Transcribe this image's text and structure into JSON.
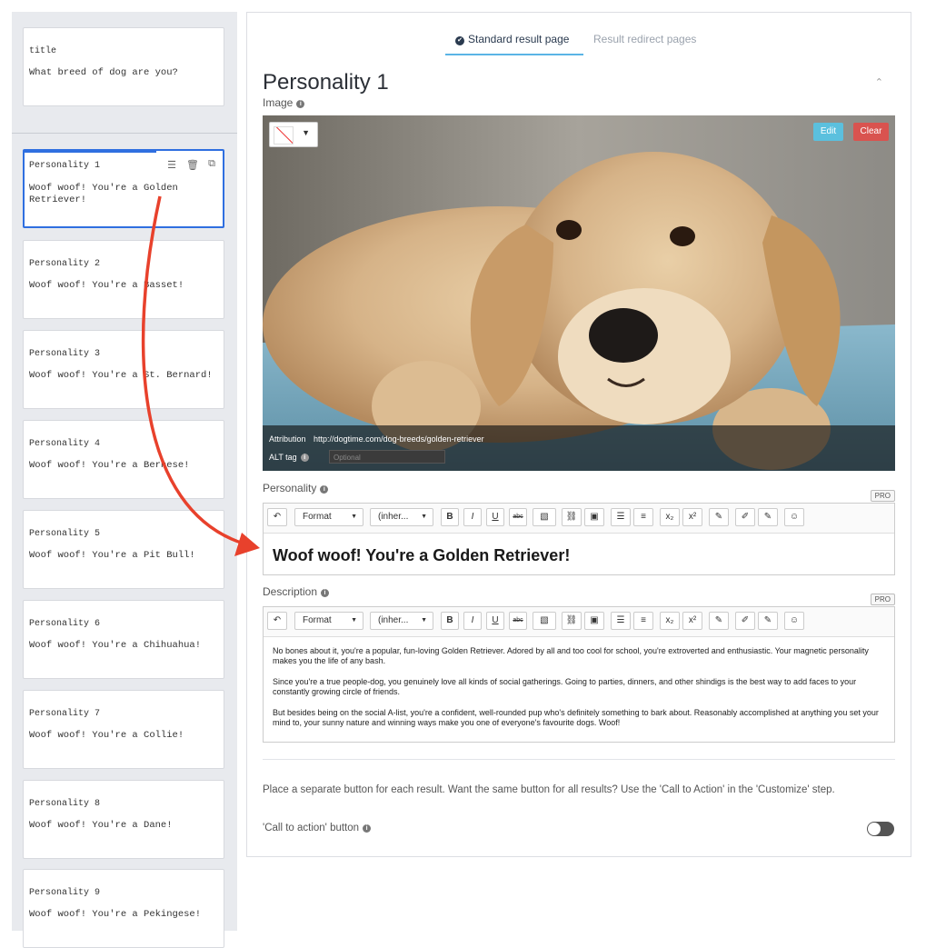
{
  "sidebar": {
    "title_card": {
      "label": "title",
      "text": "What breed of dog are you?"
    },
    "items": [
      {
        "label": "Personality 1",
        "text": "Woof woof! You're a Golden Retriever!"
      },
      {
        "label": "Personality 2",
        "text": "Woof woof! You're a Basset!"
      },
      {
        "label": "Personality 3",
        "text": "Woof woof! You're a St. Bernard!"
      },
      {
        "label": "Personality 4",
        "text": "Woof woof! You're a Bernese!"
      },
      {
        "label": "Personality 5",
        "text": "Woof woof! You're a Pit Bull!"
      },
      {
        "label": "Personality 6",
        "text": "Woof woof! You're a Chihuahua!"
      },
      {
        "label": "Personality 7",
        "text": "Woof woof! You're a Collie!"
      },
      {
        "label": "Personality 8",
        "text": "Woof woof! You're a Dane!"
      },
      {
        "label": "Personality 9",
        "text": "Woof woof! You're a Pekingese!"
      }
    ],
    "selected_index": 0,
    "tool_icons": [
      "list-icon",
      "trash-icon",
      "copy-icon"
    ]
  },
  "tabs": {
    "standard": "Standard result page",
    "redirect": "Result redirect pages",
    "active": "standard"
  },
  "main": {
    "title": "Personality 1",
    "image_label": "Image",
    "image": {
      "edit_label": "Edit",
      "clear_label": "Clear",
      "attribution_key": "Attribution",
      "attribution_value": "http://dogtime.com/dog-breeds/golden-retriever",
      "alt_label": "ALT tag",
      "alt_placeholder": "Optional"
    },
    "personality_label": "Personality",
    "personality_text": "Woof woof! You're a Golden Retriever!",
    "description_label": "Description",
    "description_paragraphs": [
      "No bones about it, you're a popular, fun-loving Golden Retriever. Adored by all and too cool for school, you're extroverted and enthusiastic. Your magnetic personality makes you the life of any bash.",
      "Since you're a true people-dog, you genuinely love all kinds of social gatherings. Going to parties, dinners, and other shindigs is the best way to add faces to your constantly growing circle of friends.",
      "But besides being on the social A-list, you're a confident, well-rounded pup who's definitely something to bark about. Reasonably accomplished at anything you set your mind to, your sunny nature and winning ways make you one of everyone's favourite dogs. Woof!"
    ],
    "pro_badge": "PRO",
    "toolbar": {
      "format": "Format",
      "font": "(inher...",
      "bold": "B",
      "italic": "I",
      "underline": "U",
      "strike": "abc",
      "sub": "x₂",
      "sup": "x²"
    },
    "cta_info": "Place a separate button for each result. Want the same button for all results? Use the 'Call to Action' in the 'Customize' step.",
    "cta_label": "'Call to action' button",
    "cta_enabled": false
  },
  "colors": {
    "accent": "#2f6fe0",
    "tab_underline": "#5ab4e5",
    "edit": "#5bc0de",
    "clear": "#d9534f",
    "arrow": "#e8412c"
  }
}
